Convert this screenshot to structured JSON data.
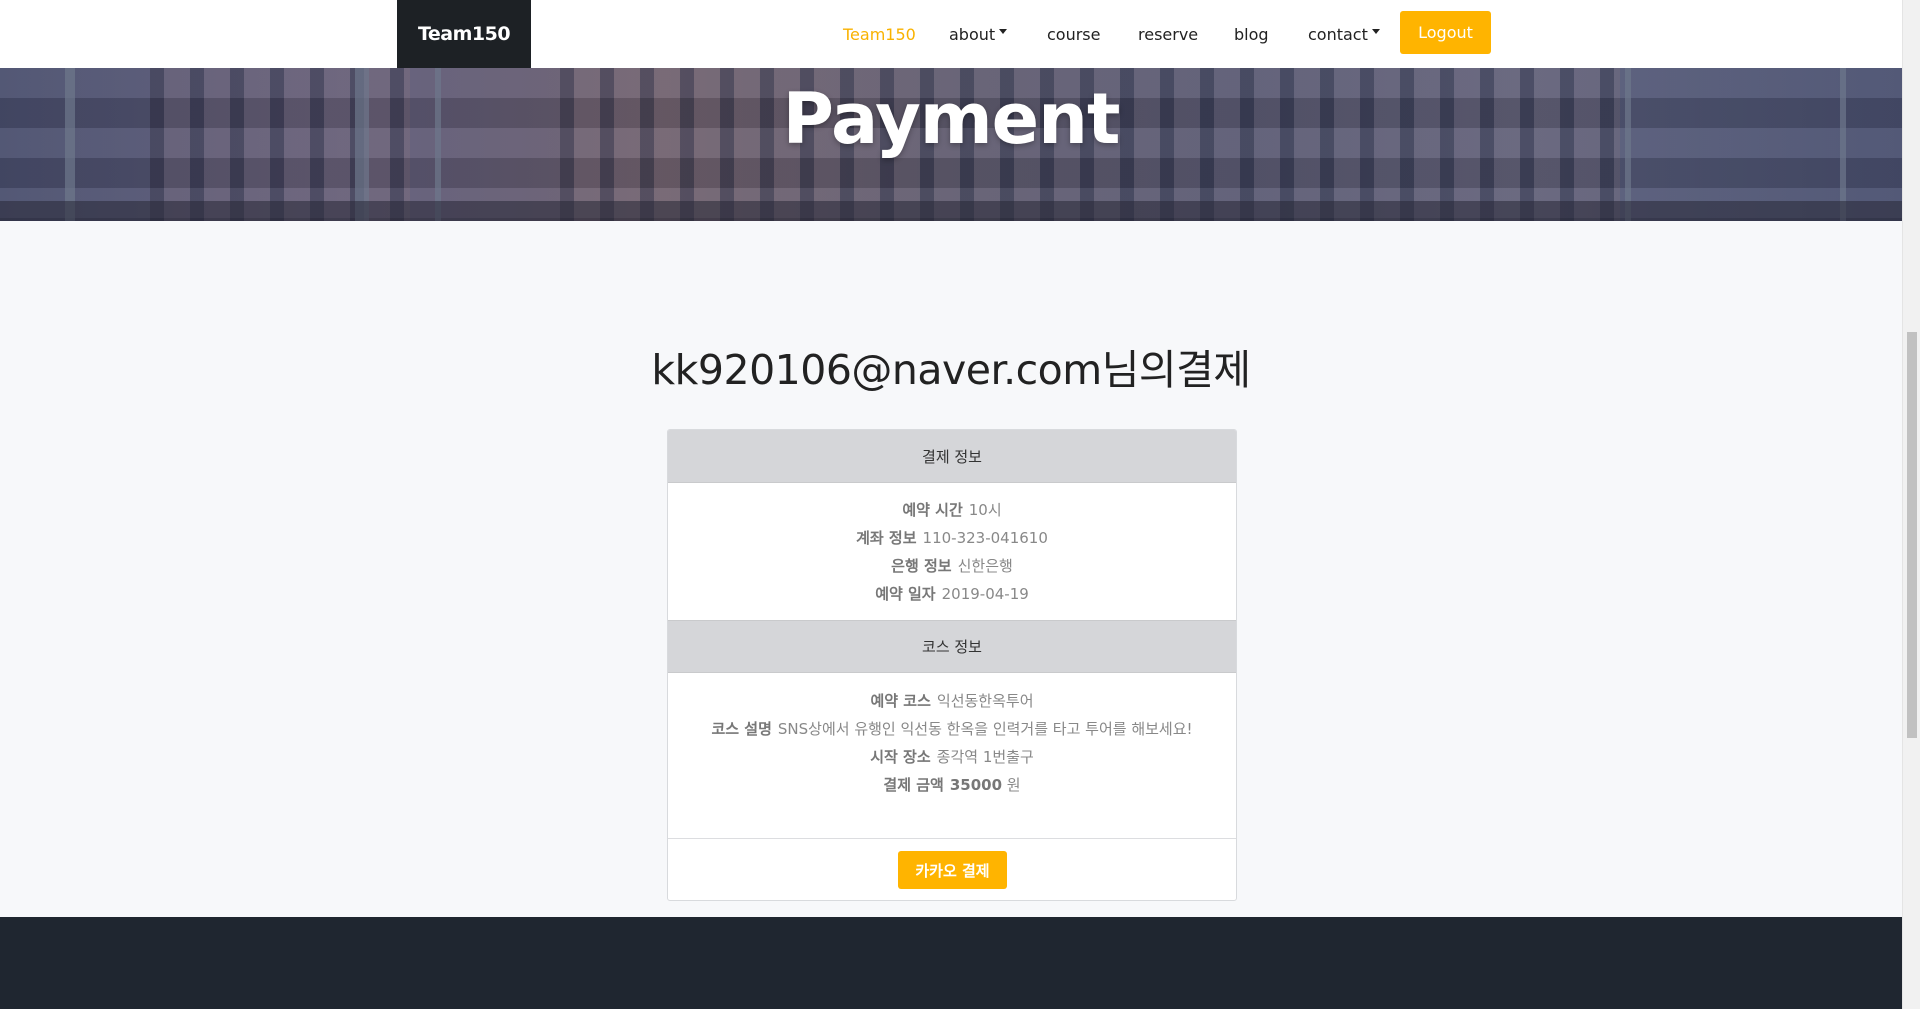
{
  "navbar": {
    "brand": "Team150",
    "items": [
      {
        "label": "Team150",
        "active": true,
        "dropdown": false
      },
      {
        "label": "about",
        "active": false,
        "dropdown": true
      },
      {
        "label": "course",
        "active": false,
        "dropdown": false
      },
      {
        "label": "reserve",
        "active": false,
        "dropdown": false
      },
      {
        "label": "blog",
        "active": false,
        "dropdown": false
      },
      {
        "label": "contact",
        "active": false,
        "dropdown": true
      }
    ],
    "logout_label": "Logout"
  },
  "hero": {
    "title": "Payment"
  },
  "heading": "kk920106@naver.com님의결제",
  "payment_info": {
    "title": "결제 정보",
    "rows": [
      {
        "label": "예약 시간",
        "value": "10시"
      },
      {
        "label": "계좌 정보",
        "value": "110-323-041610"
      },
      {
        "label": "은행 정보",
        "value": "신한은행"
      },
      {
        "label": "예약 일자",
        "value": "2019-04-19"
      }
    ]
  },
  "course_info": {
    "title": "코스 정보",
    "rows": [
      {
        "label": "예약 코스",
        "value": "익선동한옥투어"
      },
      {
        "label": "코스 설명",
        "value": "SNS상에서 유행인 익선동 한옥을 인력거를 타고 투어를 해보세요!"
      },
      {
        "label": "시작 장소",
        "value": "종각역 1번출구"
      }
    ],
    "amount": {
      "label": "결제 금액",
      "value": "35000",
      "unit": "원"
    }
  },
  "kakao_button": "카카오 결제",
  "colors": {
    "accent": "#ffb400",
    "active_nav": "#f9b200",
    "brand_bg": "#1d2125",
    "footer_bg": "#1f2630"
  }
}
